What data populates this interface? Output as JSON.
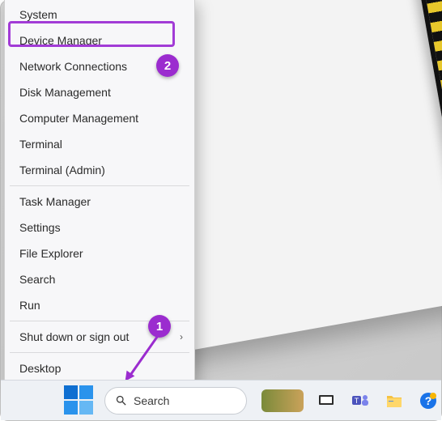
{
  "menu": {
    "items": [
      "System",
      "Device Manager",
      "Network Connections",
      "Disk Management",
      "Computer Management",
      "Terminal",
      "Terminal (Admin)"
    ],
    "items2": [
      "Task Manager",
      "Settings",
      "File Explorer",
      "Search",
      "Run"
    ],
    "items3": [
      "Shut down or sign out"
    ],
    "items4": [
      "Desktop"
    ],
    "highlighted_index": 1
  },
  "callouts": {
    "one": "1",
    "two": "2"
  },
  "colors": {
    "accent": "#9b2ccf",
    "taskbar_bg": "#eef1f5",
    "start_blue": "#1f8ae0"
  },
  "taskbar": {
    "search_label": "Search",
    "icons": [
      "task-view",
      "teams",
      "file-explorer",
      "tips"
    ]
  }
}
